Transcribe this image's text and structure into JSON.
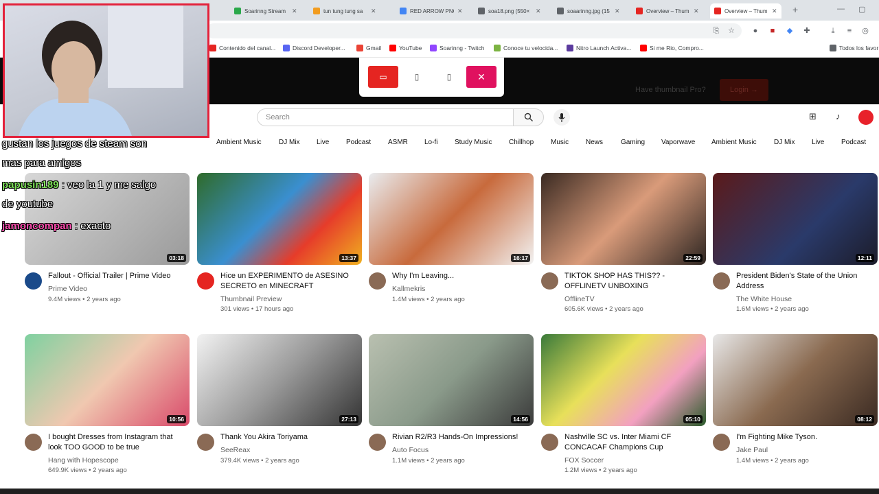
{
  "tabs": [
    {
      "title": "Soarinng Stream",
      "color": "#2aa84a"
    },
    {
      "title": "tun tung tung sa",
      "color": "#f29c1f"
    },
    {
      "title": "RED ARROW PNG",
      "color": "#4285f4"
    },
    {
      "title": "soa18.png (550×",
      "color": "#5f6368"
    },
    {
      "title": "soaarinng.jpg (15",
      "color": "#5f6368"
    },
    {
      "title": "Overview – Thum",
      "color": "#e52521"
    },
    {
      "title": "Overview – Thum",
      "color": "#e52521"
    }
  ],
  "bookmarks": [
    {
      "label": "Contenido del canal...",
      "color": "#e52521"
    },
    {
      "label": "Discord Developer...",
      "color": "#5865f2"
    },
    {
      "label": "Gmail",
      "color": "#ea4335"
    },
    {
      "label": "YouTube",
      "color": "#ff0000"
    },
    {
      "label": "Soarinng - Twitch",
      "color": "#9146ff"
    },
    {
      "label": "Conoce tu velocida...",
      "color": "#7cb342"
    },
    {
      "label": "Nitro Launch Activa...",
      "color": "#5b3b9e"
    },
    {
      "label": "Si me Rio, Compro...",
      "color": "#ff0000"
    },
    {
      "label": "Todos los favor",
      "color": "#5f6368"
    }
  ],
  "header": {
    "pro_text": "Have thumbnail Pro?",
    "login_label": "Login →"
  },
  "search": {
    "placeholder": "Search"
  },
  "chips": [
    "Ambient Music",
    "DJ Mix",
    "Live",
    "Podcast",
    "ASMR",
    "Lo-fi",
    "Study Music",
    "Chillhop",
    "Music",
    "News",
    "Gaming",
    "Vaporwave",
    "Ambient Music",
    "DJ Mix",
    "Live",
    "Podcast"
  ],
  "videos": [
    {
      "title": "Fallout - Official Trailer | Prime Video",
      "channel": "Prime Video",
      "meta": "9.4M views • 2 years ago",
      "duration": "03:18",
      "bg": "linear-gradient(135deg,#d7d7d7,#9a9a9a)",
      "avatar": "#1a4a8a"
    },
    {
      "title": "Hice un EXPERIMENTO de ASESINO SECRETO en MINECRAFT",
      "channel": "Thumbnail Preview",
      "meta": "301 views • 17 hours ago",
      "duration": "13:37",
      "bg": "linear-gradient(135deg,#2f6b2a,#3a8fd0 45%,#e63c2a 70%,#f0b020)",
      "avatar": "#e52521"
    },
    {
      "title": "Why I'm Leaving...",
      "channel": "Kallmekris",
      "meta": "1.4M views • 2 years ago",
      "duration": "16:17",
      "bg": "linear-gradient(135deg,#e9ecef,#c86a3c 50%,#f2f2f2)",
      "avatar": "#8a6a55"
    },
    {
      "title": "TIKTOK SHOP HAS THIS?? - OFFLINETV UNBOXING",
      "channel": "OfflineTV",
      "meta": "605.6K views • 2 years ago",
      "duration": "22:59",
      "bg": "linear-gradient(135deg,#3a2a22,#d99b7a 50%,#2e2622)",
      "avatar": "#8a6a55"
    },
    {
      "title": "President Biden's State of the Union Address",
      "channel": "The White House",
      "meta": "1.6M views • 2 years ago",
      "duration": "12:11",
      "bg": "linear-gradient(135deg,#5b1a1a,#2a3a6a 60%,#1c1c2a)",
      "avatar": "#8a6a55"
    },
    {
      "title": "I bought Dresses from Instagram that look TOO GOOD to be true",
      "channel": "Hang with Hopescope",
      "meta": "649.9K views • 2 years ago",
      "duration": "10:56",
      "bg": "linear-gradient(135deg,#7fd1a0,#f0c8b0 50%,#d94a6a)",
      "avatar": "#8a6a55"
    },
    {
      "title": "Thank You Akira Toriyama",
      "channel": "SeeReax",
      "meta": "379.4K views • 2 years ago",
      "duration": "27:13",
      "bg": "linear-gradient(135deg,#f2f2f2,#9a9a9a 50%,#333)",
      "avatar": "#8a6a55"
    },
    {
      "title": "Rivian R2/R3 Hands-On Impressions!",
      "channel": "Auto Focus",
      "meta": "1.1M views • 2 years ago",
      "duration": "14:56",
      "bg": "linear-gradient(135deg,#b9c0b0,#8a9a8a 50%,#3a3a3a)",
      "avatar": "#8a6a55"
    },
    {
      "title": "Nashville SC vs. Inter Miami CF CONCACAF Champions Cup",
      "channel": "FOX Soccer",
      "meta": "1.2M views • 2 years ago",
      "duration": "05:10",
      "bg": "linear-gradient(135deg,#3a7a3a,#e8e05a 40%,#f2a0c0 70%,#2a5a2a)",
      "avatar": "#8a6a55"
    },
    {
      "title": "I'm Fighting Mike Tyson.",
      "channel": "Jake Paul",
      "meta": "1.4M views • 2 years ago",
      "duration": "08:12",
      "bg": "linear-gradient(135deg,#e8e8e8,#8a6a50 50%,#3a2a22)",
      "avatar": "#8a6a55"
    }
  ],
  "chat": [
    {
      "user": "",
      "text": "gustan los juegos de steam son",
      "color": "#ffffff"
    },
    {
      "user": "",
      "text": "mas para amigos",
      "color": "#ffffff"
    },
    {
      "user": "papusin189",
      "text": " : veo la 1 y me salgo",
      "color": "#7ee05a"
    },
    {
      "user": "",
      "text": "de youtube",
      "color": "#ffffff"
    },
    {
      "user": "jamoncompan",
      "text": " : exacto",
      "color": "#ff4fb0"
    }
  ]
}
